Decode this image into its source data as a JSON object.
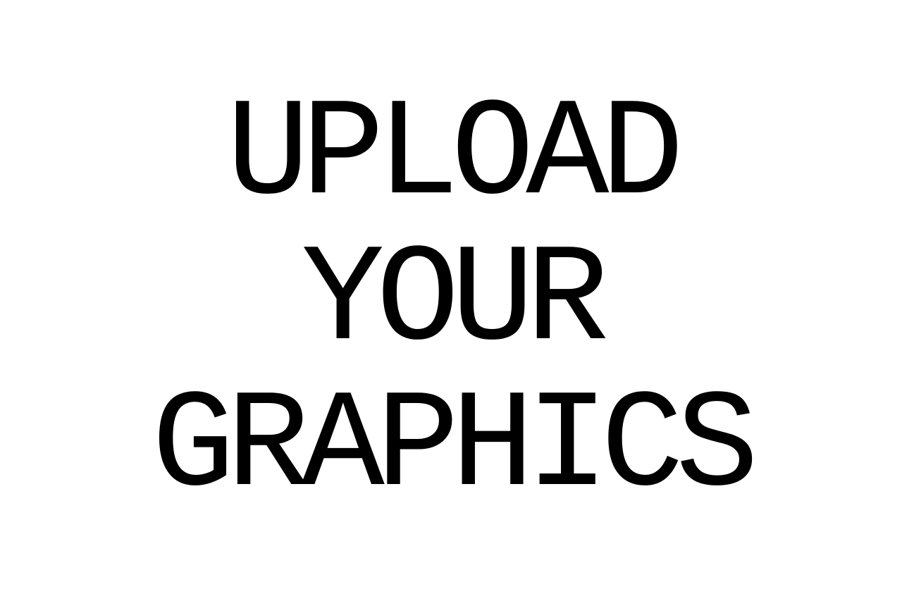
{
  "headline": {
    "lines": [
      "UPLOAD",
      "YOUR",
      "GRAPHICS"
    ]
  },
  "colors": {
    "background": "#ffffff",
    "text": "#000000"
  }
}
